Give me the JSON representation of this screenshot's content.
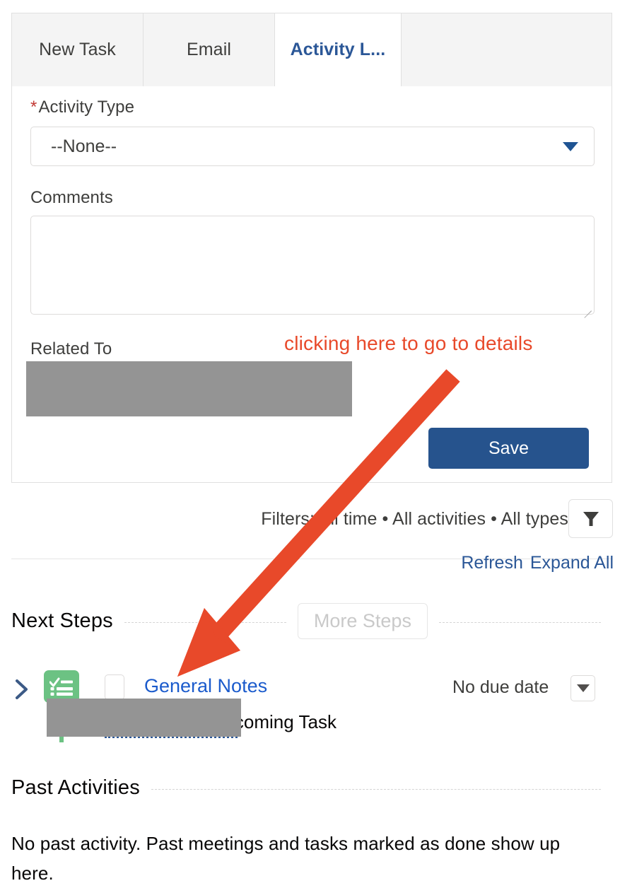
{
  "tabs": [
    {
      "label": "New Task",
      "active": false
    },
    {
      "label": "Email",
      "active": false
    },
    {
      "label": "Activity L...",
      "active": true
    },
    {
      "label": "",
      "active": false
    }
  ],
  "form": {
    "activity_type": {
      "required_marker": "*",
      "label": "Activity Type",
      "value": "--None--",
      "caret_icon": "chevron-down-icon"
    },
    "comments": {
      "label": "Comments",
      "value": "",
      "placeholder": ""
    },
    "related_to": {
      "label": "Related To",
      "value": ""
    },
    "save_label": "Save"
  },
  "annotation": {
    "text": "clicking here to go to details",
    "color": "#e8492a",
    "arrow_icon": "arrow-down-left-icon"
  },
  "filters": {
    "summary": "Filters: All time • All activities • All types",
    "filter_icon": "funnel-icon"
  },
  "toolbar_links": {
    "refresh": "Refresh",
    "expand_all": "Expand All"
  },
  "next_steps": {
    "title": "Next Steps",
    "more_steps_label": "More Steps",
    "task": {
      "expand_icon": "chevron-right-icon",
      "type_icon": "task-checklist-icon",
      "checkbox_icon": "checkbox-unchecked-icon",
      "subject": "General Notes",
      "due_date": "No due date",
      "menu_icon": "chevron-down-icon",
      "description_suffix": "has an upcoming Task",
      "description_redacted": ""
    }
  },
  "past_activities": {
    "title": "Past Activities",
    "empty_message": "No past activity. Past meetings and tasks marked as done show up here."
  },
  "colors": {
    "accent_blue": "#26538d",
    "link_blue": "#2b5797",
    "task_green": "#6cc283",
    "annotation_red": "#e8492a",
    "required_red": "#c23934",
    "redaction_gray": "#949494"
  }
}
